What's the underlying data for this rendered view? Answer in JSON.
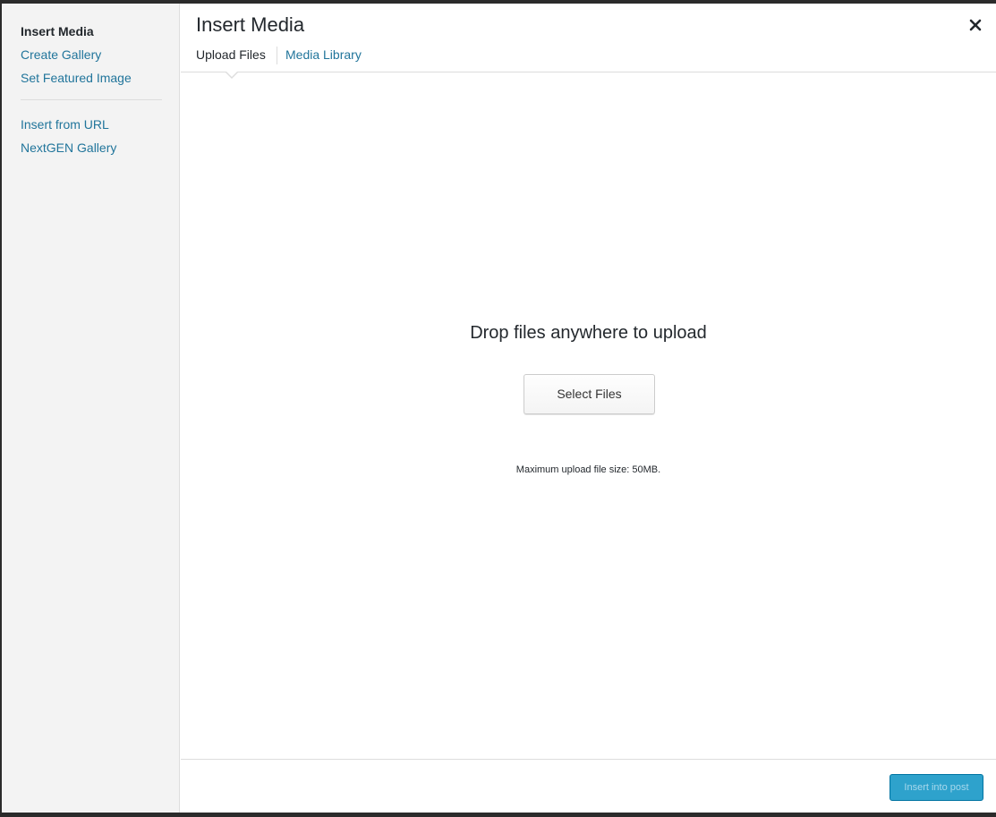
{
  "menu": {
    "items": [
      {
        "label": "Insert Media",
        "active": true
      },
      {
        "label": "Create Gallery",
        "active": false
      },
      {
        "label": "Set Featured Image",
        "active": false
      },
      {
        "label": "Insert from URL",
        "active": false
      },
      {
        "label": "NextGEN Gallery",
        "active": false
      }
    ]
  },
  "header": {
    "title": "Insert Media",
    "close_icon": "close-icon",
    "tabs": [
      {
        "label": "Upload Files",
        "active": true
      },
      {
        "label": "Media Library",
        "active": false
      }
    ]
  },
  "upload": {
    "drop_text": "Drop files anywhere to upload",
    "select_button": "Select Files",
    "max_size_text": "Maximum upload file size: 50MB."
  },
  "toolbar": {
    "insert_button": "Insert into post",
    "insert_enabled": false
  },
  "colors": {
    "link": "#21759b",
    "primary_button": "#2ea2cc",
    "sidebar_bg": "#f3f3f3"
  }
}
